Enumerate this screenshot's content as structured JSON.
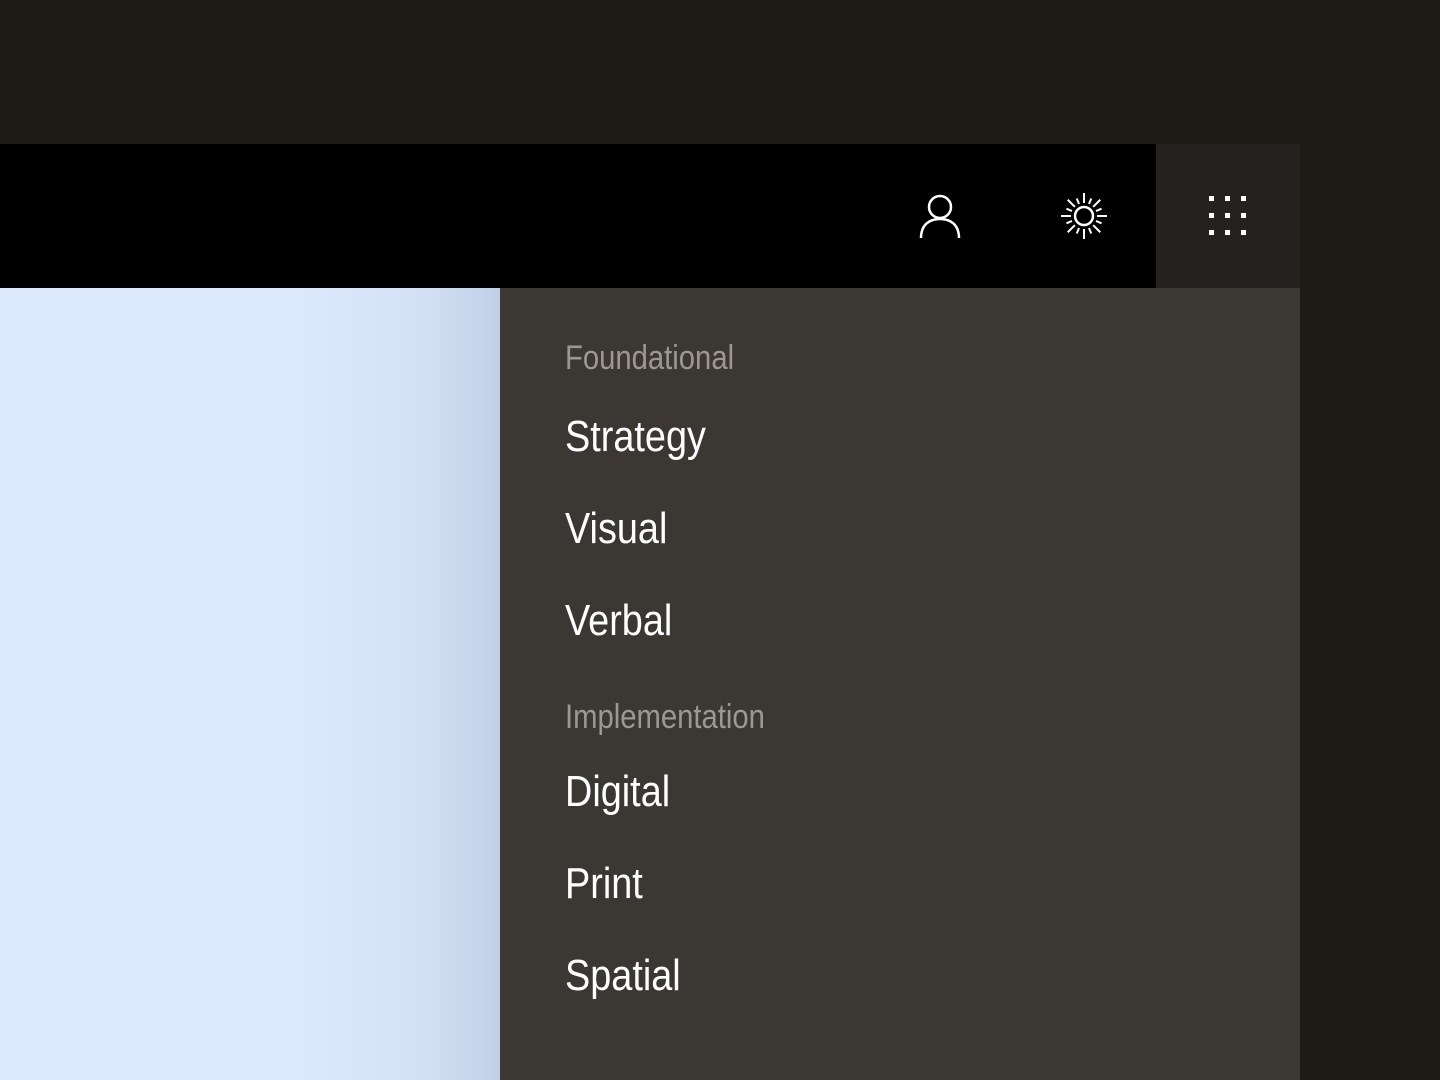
{
  "topbar": {
    "icons": {
      "account": "user-icon",
      "theme": "sun-icon",
      "apps": "apps-grid-icon"
    }
  },
  "menu": {
    "sections": [
      {
        "heading": "Foundational",
        "items": [
          "Strategy",
          "Visual",
          "Verbal"
        ]
      },
      {
        "heading": "Implementation",
        "items": [
          "Digital",
          "Print",
          "Spatial"
        ]
      }
    ]
  },
  "colors": {
    "page_background": "#1e1b17",
    "topbar": "#000000",
    "apps_button_active": "#24221e",
    "menu_panel": "#3b3834",
    "content_area": "#dde9fd",
    "heading_text": "#9c9891",
    "item_text": "#ffffff"
  }
}
